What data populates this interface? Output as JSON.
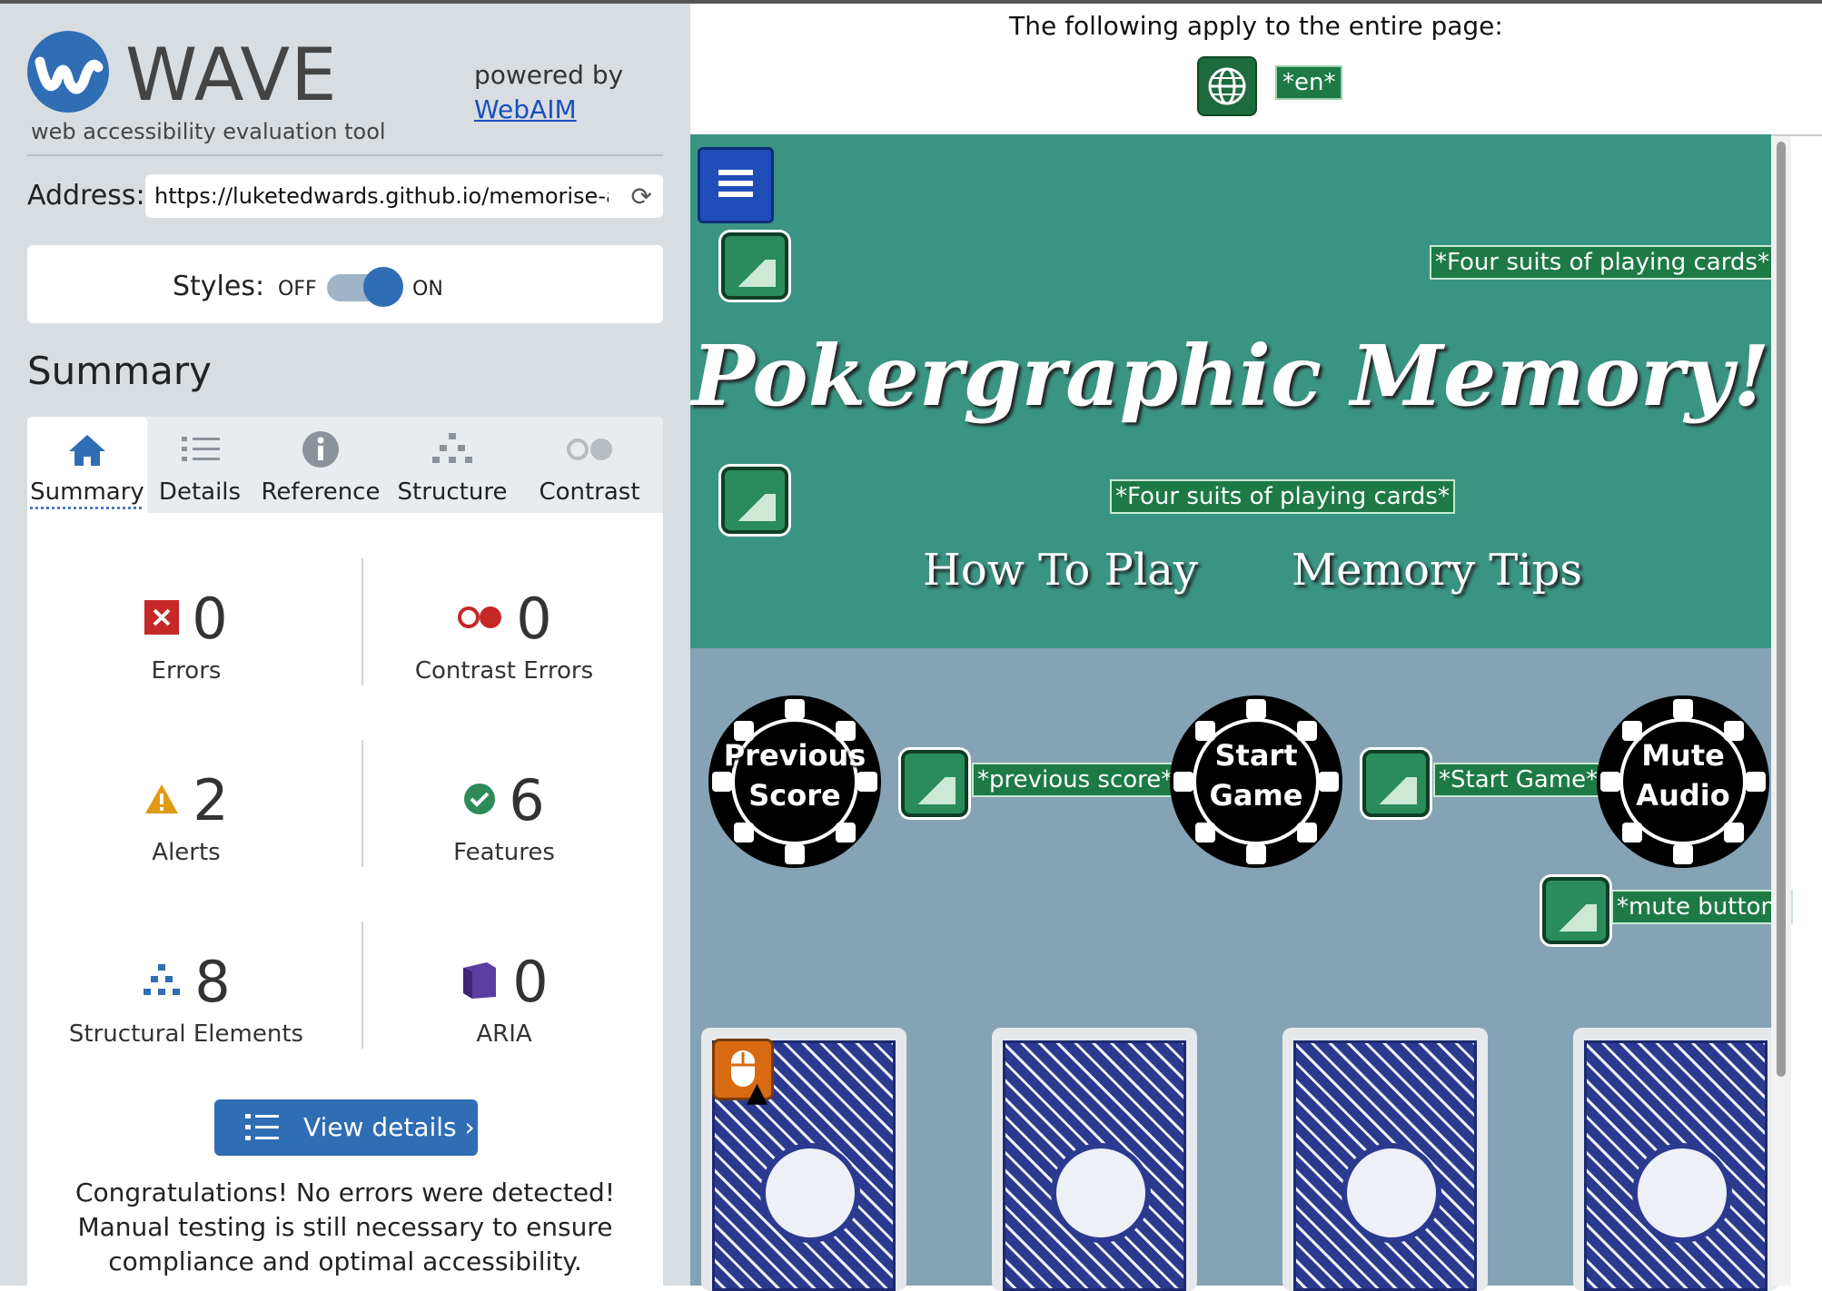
{
  "wave": {
    "logo": "WAVE",
    "subtitle": "web accessibility evaluation tool",
    "powered_by": "powered by",
    "webaim_link": "WebAIM",
    "address_label": "Address:",
    "address_value": "https://luketedwards.github.io/memorise-a-",
    "styles_label": "Styles:",
    "styles_off": "OFF",
    "styles_on": "ON",
    "summary_heading": "Summary",
    "tabs": [
      {
        "label": "Summary",
        "icon": "home-icon"
      },
      {
        "label": "Details",
        "icon": "list-icon"
      },
      {
        "label": "Reference",
        "icon": "info-icon"
      },
      {
        "label": "Structure",
        "icon": "hierarchy-icon"
      },
      {
        "label": "Contrast",
        "icon": "contrast-icon"
      }
    ],
    "stats": {
      "errors": {
        "value": "0",
        "label": "Errors",
        "color": "#c62828"
      },
      "contrast": {
        "value": "0",
        "label": "Contrast Errors",
        "color": "#c62828"
      },
      "alerts": {
        "value": "2",
        "label": "Alerts",
        "color": "#e09a14"
      },
      "features": {
        "value": "6",
        "label": "Features",
        "color": "#2e8b57"
      },
      "structural": {
        "value": "8",
        "label": "Structural Elements",
        "color": "#2f6db5"
      },
      "aria": {
        "value": "0",
        "label": "ARIA",
        "color": "#5b3ea1"
      }
    },
    "view_details": "View details ›",
    "congrats": "Congratulations! No errors were detected! Manual testing is still necessary to ensure compliance and optimal accessibility."
  },
  "page": {
    "apply_text": "The following apply to the entire page:",
    "lang_tag": "*en*",
    "alt_tag_1": "*Four suits of playing cards*",
    "title": "Pokergraphic Memory!",
    "alt_tag_2": "*Four suits of playing cards*",
    "nav": [
      "How To Play",
      "Memory Tips"
    ],
    "chips": [
      {
        "line1": "Previous",
        "line2": "Score"
      },
      {
        "line1": "Start",
        "line2": "Game"
      },
      {
        "line1": "Mute",
        "line2": "Audio"
      }
    ],
    "tag_previous": "*previous score*",
    "tag_start": "*Start Game*",
    "tag_mute": "*mute button*",
    "colors": {
      "teal": "#3a9482",
      "grey_blue": "#86a3b5",
      "wave_blue": "#2f6db5"
    }
  }
}
